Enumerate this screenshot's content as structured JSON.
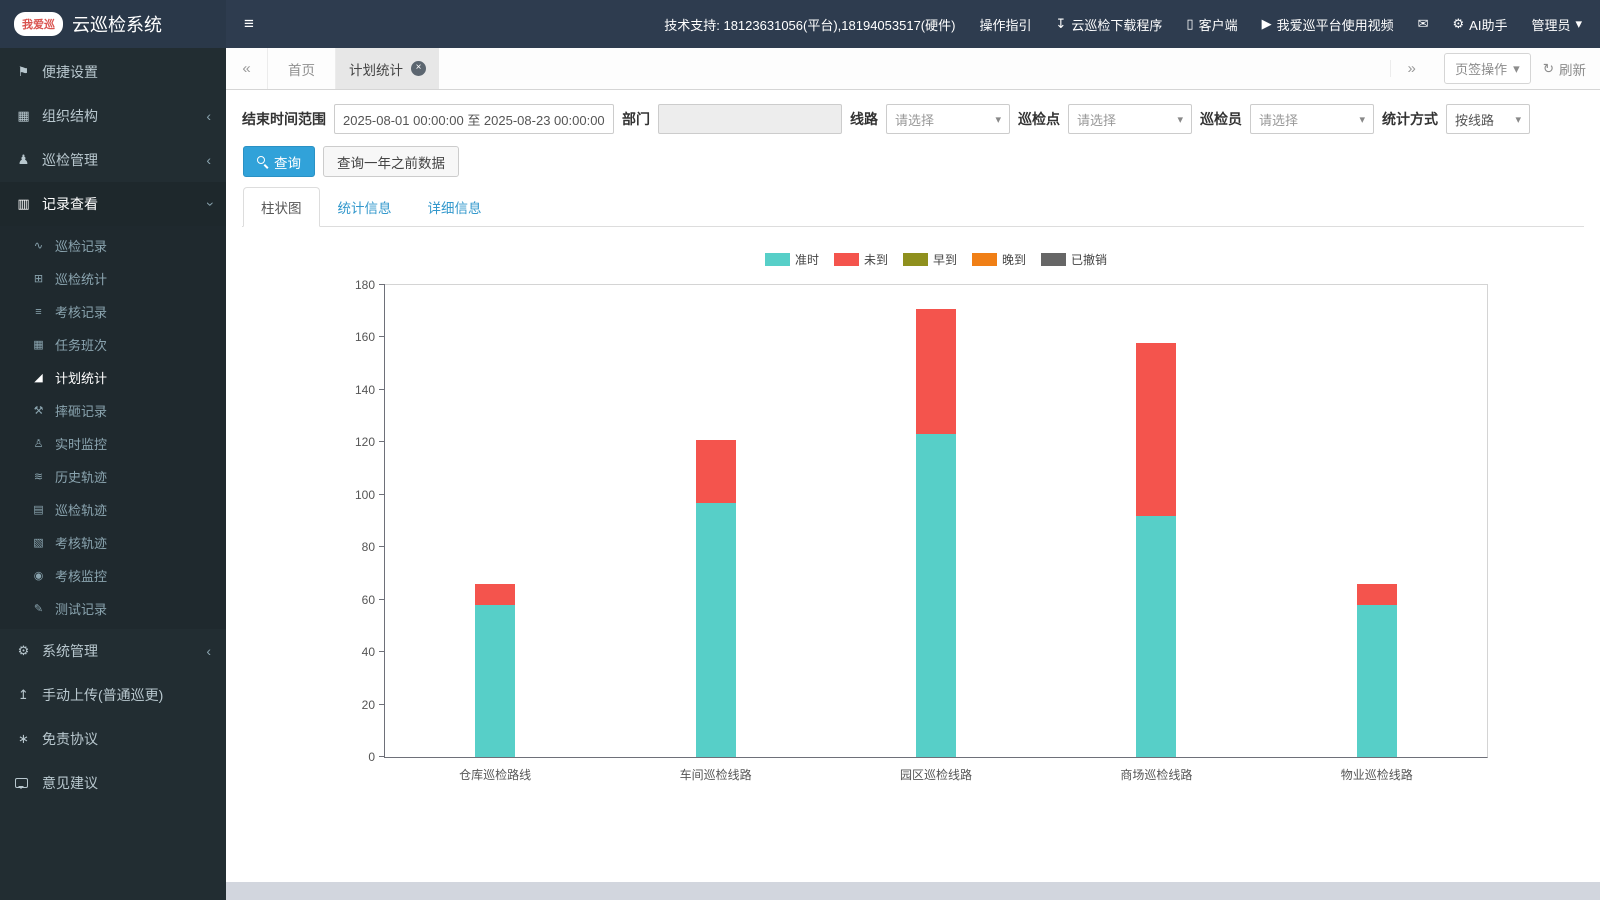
{
  "app": {
    "logo_badge": "我爱巡",
    "title": "云巡检系统"
  },
  "icons": {
    "hamburger": "≡",
    "download": "↧",
    "mobile": "▯",
    "video": "▶",
    "envelope": "✉",
    "gear": "⚙",
    "caret_down": "▾",
    "back": "«",
    "forward": "»",
    "close": "×",
    "refresh": "↻",
    "chevron": "‹",
    "flag": "⚑",
    "org": "▦",
    "patrol": "♟",
    "records": "▥",
    "system": "⚙",
    "upload": "↥",
    "disclaimer": "∗",
    "line_chart": "∿",
    "table": "⊞",
    "list": "≡",
    "calendar": "▦",
    "area_chart": "◢",
    "hammer": "⚒",
    "monitor": "♙",
    "history": "≋",
    "track": "▤",
    "assess_track": "▧",
    "marker": "◉",
    "pencil": "✎"
  },
  "topbar": {
    "support": "技术支持: 18123631056(平台),18194053517(硬件)",
    "guide": "操作指引",
    "download": "云巡检下载程序",
    "client": "客户端",
    "video": "我爱巡平台使用视频",
    "ai": "AI助手",
    "admin": "管理员"
  },
  "sidebar": {
    "quick": "便捷设置",
    "org": "组织结构",
    "patrol": "巡检管理",
    "records": "记录查看",
    "system": "系统管理",
    "upload": "手动上传(普通巡更)",
    "disclaimer": "免责协议",
    "feedback": "意见建议",
    "submenu": [
      "巡检记录",
      "巡检统计",
      "考核记录",
      "任务班次",
      "计划统计",
      "摔砸记录",
      "实时监控",
      "历史轨迹",
      "巡检轨迹",
      "考核轨迹",
      "考核监控",
      "测试记录"
    ]
  },
  "tabstrip": {
    "home": "首页",
    "active": "计划统计",
    "ops": "页签操作",
    "refresh": "刷新"
  },
  "filters": {
    "date_label": "结束时间范围",
    "date_value": "2025-08-01 00:00:00 至 2025-08-23 00:00:00",
    "dept_label": "部门",
    "dept_value": "",
    "line_label": "线路",
    "line_value": "请选择",
    "point_label": "巡检点",
    "point_value": "请选择",
    "person_label": "巡检员",
    "person_value": "请选择",
    "stat_label": "统计方式",
    "stat_value": "按线路",
    "search_btn": "查询",
    "year_btn": "查询一年之前数据"
  },
  "view_tabs": {
    "bar": "柱状图",
    "stats": "统计信息",
    "detail": "详细信息"
  },
  "chart_data": {
    "type": "bar",
    "stacked": true,
    "title": "",
    "categories": [
      "仓库巡检路线",
      "车间巡检线路",
      "园区巡检线路",
      "商场巡检线路",
      "物业巡检线路"
    ],
    "series": [
      {
        "name": "准时",
        "color": "#57cfc8",
        "values": [
          58,
          97,
          123,
          92,
          58
        ]
      },
      {
        "name": "未到",
        "color": "#f4544d",
        "values": [
          8,
          24,
          48,
          66,
          8
        ]
      },
      {
        "name": "早到",
        "color": "#8f901e",
        "values": [
          0,
          0,
          0,
          0,
          0
        ]
      },
      {
        "name": "晚到",
        "color": "#f07f16",
        "values": [
          0,
          0,
          0,
          0,
          0
        ]
      },
      {
        "name": "已撤销",
        "color": "#666666",
        "values": [
          0,
          0,
          0,
          0,
          0
        ]
      }
    ],
    "ylim": [
      0,
      180
    ],
    "ytick_step": 20,
    "legend_position": "top",
    "grid": false
  }
}
